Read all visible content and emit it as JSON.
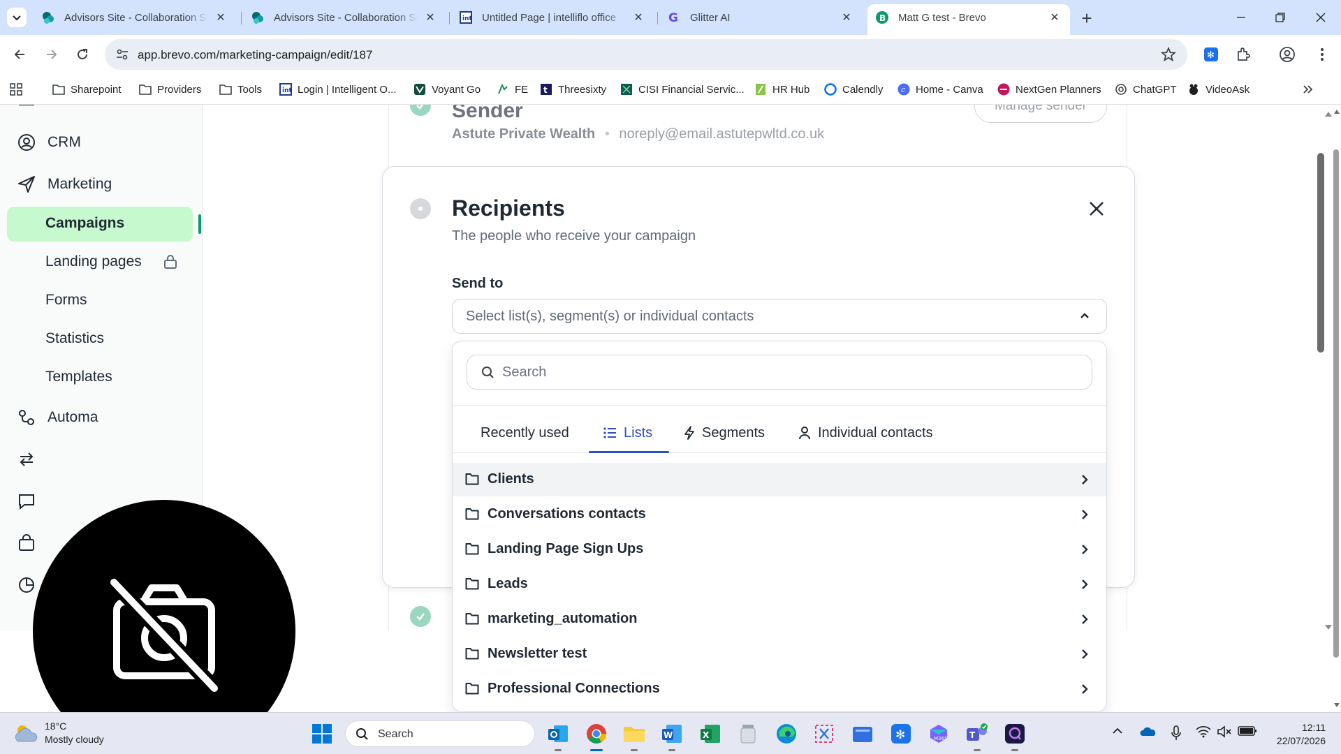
{
  "browser": {
    "tabs": [
      {
        "title": "Advisors Site - Collaboration Site",
        "icon": "sharepoint-icon",
        "active": false
      },
      {
        "title": "Advisors Site - Collaboration Site",
        "icon": "sharepoint-icon",
        "active": false
      },
      {
        "title": "Untitled Page | intelliflo office",
        "icon": "intelliflo-icon",
        "active": false
      },
      {
        "title": "Glitter AI",
        "icon": "glitter-icon",
        "active": false
      },
      {
        "title": "Matt G test - Brevo",
        "icon": "brevo-icon",
        "active": true
      }
    ],
    "url": "app.brevo.com/marketing-campaign/edit/187",
    "bookmarks": [
      {
        "label": "Sharepoint",
        "icon": "folder-icon"
      },
      {
        "label": "Providers",
        "icon": "folder-icon"
      },
      {
        "label": "Tools",
        "icon": "folder-icon"
      },
      {
        "label": "Login | Intelligent O...",
        "icon": "intelliflo-icon"
      },
      {
        "label": "Voyant Go",
        "icon": "voyant-icon"
      },
      {
        "label": "FE",
        "icon": "fe-icon"
      },
      {
        "label": "Threesixty",
        "icon": "threesixty-icon"
      },
      {
        "label": "CISI Financial Servic...",
        "icon": "cisi-icon"
      },
      {
        "label": "HR Hub",
        "icon": "hrhub-icon"
      },
      {
        "label": "Calendly",
        "icon": "calendly-icon"
      },
      {
        "label": "Home - Canva",
        "icon": "canva-icon"
      },
      {
        "label": "NextGen Planners",
        "icon": "nextgen-icon"
      },
      {
        "label": "ChatGPT",
        "icon": "chatgpt-icon"
      },
      {
        "label": "VideoAsk",
        "icon": "videoask-icon"
      }
    ]
  },
  "sidebar": {
    "items": [
      {
        "label": "CRM",
        "icon": "crm-icon"
      },
      {
        "label": "Marketing",
        "icon": "send-icon"
      },
      {
        "label": "Automa",
        "icon": "automation-icon"
      }
    ],
    "subitems": [
      "Campaigns",
      "Landing pages",
      "Forms",
      "Statistics",
      "Templates"
    ],
    "active": "Campaigns"
  },
  "sender": {
    "title": "Sender",
    "name": "Astute Private Wealth",
    "separator": "•",
    "email": "noreply@email.astutepwltd.co.uk",
    "manage_label": "Manage sender"
  },
  "recipients": {
    "title": "Recipients",
    "subtitle": "The people who receive your campaign",
    "send_to_label": "Send to",
    "select_placeholder": "Select list(s), segment(s) or individual contacts",
    "search_placeholder": "Search",
    "tabs": [
      {
        "label": "Recently used",
        "icon": ""
      },
      {
        "label": "Lists",
        "icon": "list-icon"
      },
      {
        "label": "Segments",
        "icon": "bolt-icon"
      },
      {
        "label": "Individual contacts",
        "icon": "person-icon"
      }
    ],
    "active_tab": "Lists",
    "lists": [
      "Clients",
      "Conversations contacts",
      "Landing Page Sign Ups",
      "Leads",
      "marketing_automation",
      "Newsletter test",
      "Professional Connections"
    ]
  },
  "taskbar": {
    "weather_temp": "18°C",
    "weather_desc": "Mostly cloudy",
    "search_placeholder": "Search",
    "time": "12:11",
    "date": "22/07/2026"
  },
  "colors": {
    "accent_green": "#0b996e",
    "active_pill": "#c7f9cf",
    "tab_blue": "#2f4dbf",
    "chrome_tabstrip": "#d3e3fd"
  }
}
